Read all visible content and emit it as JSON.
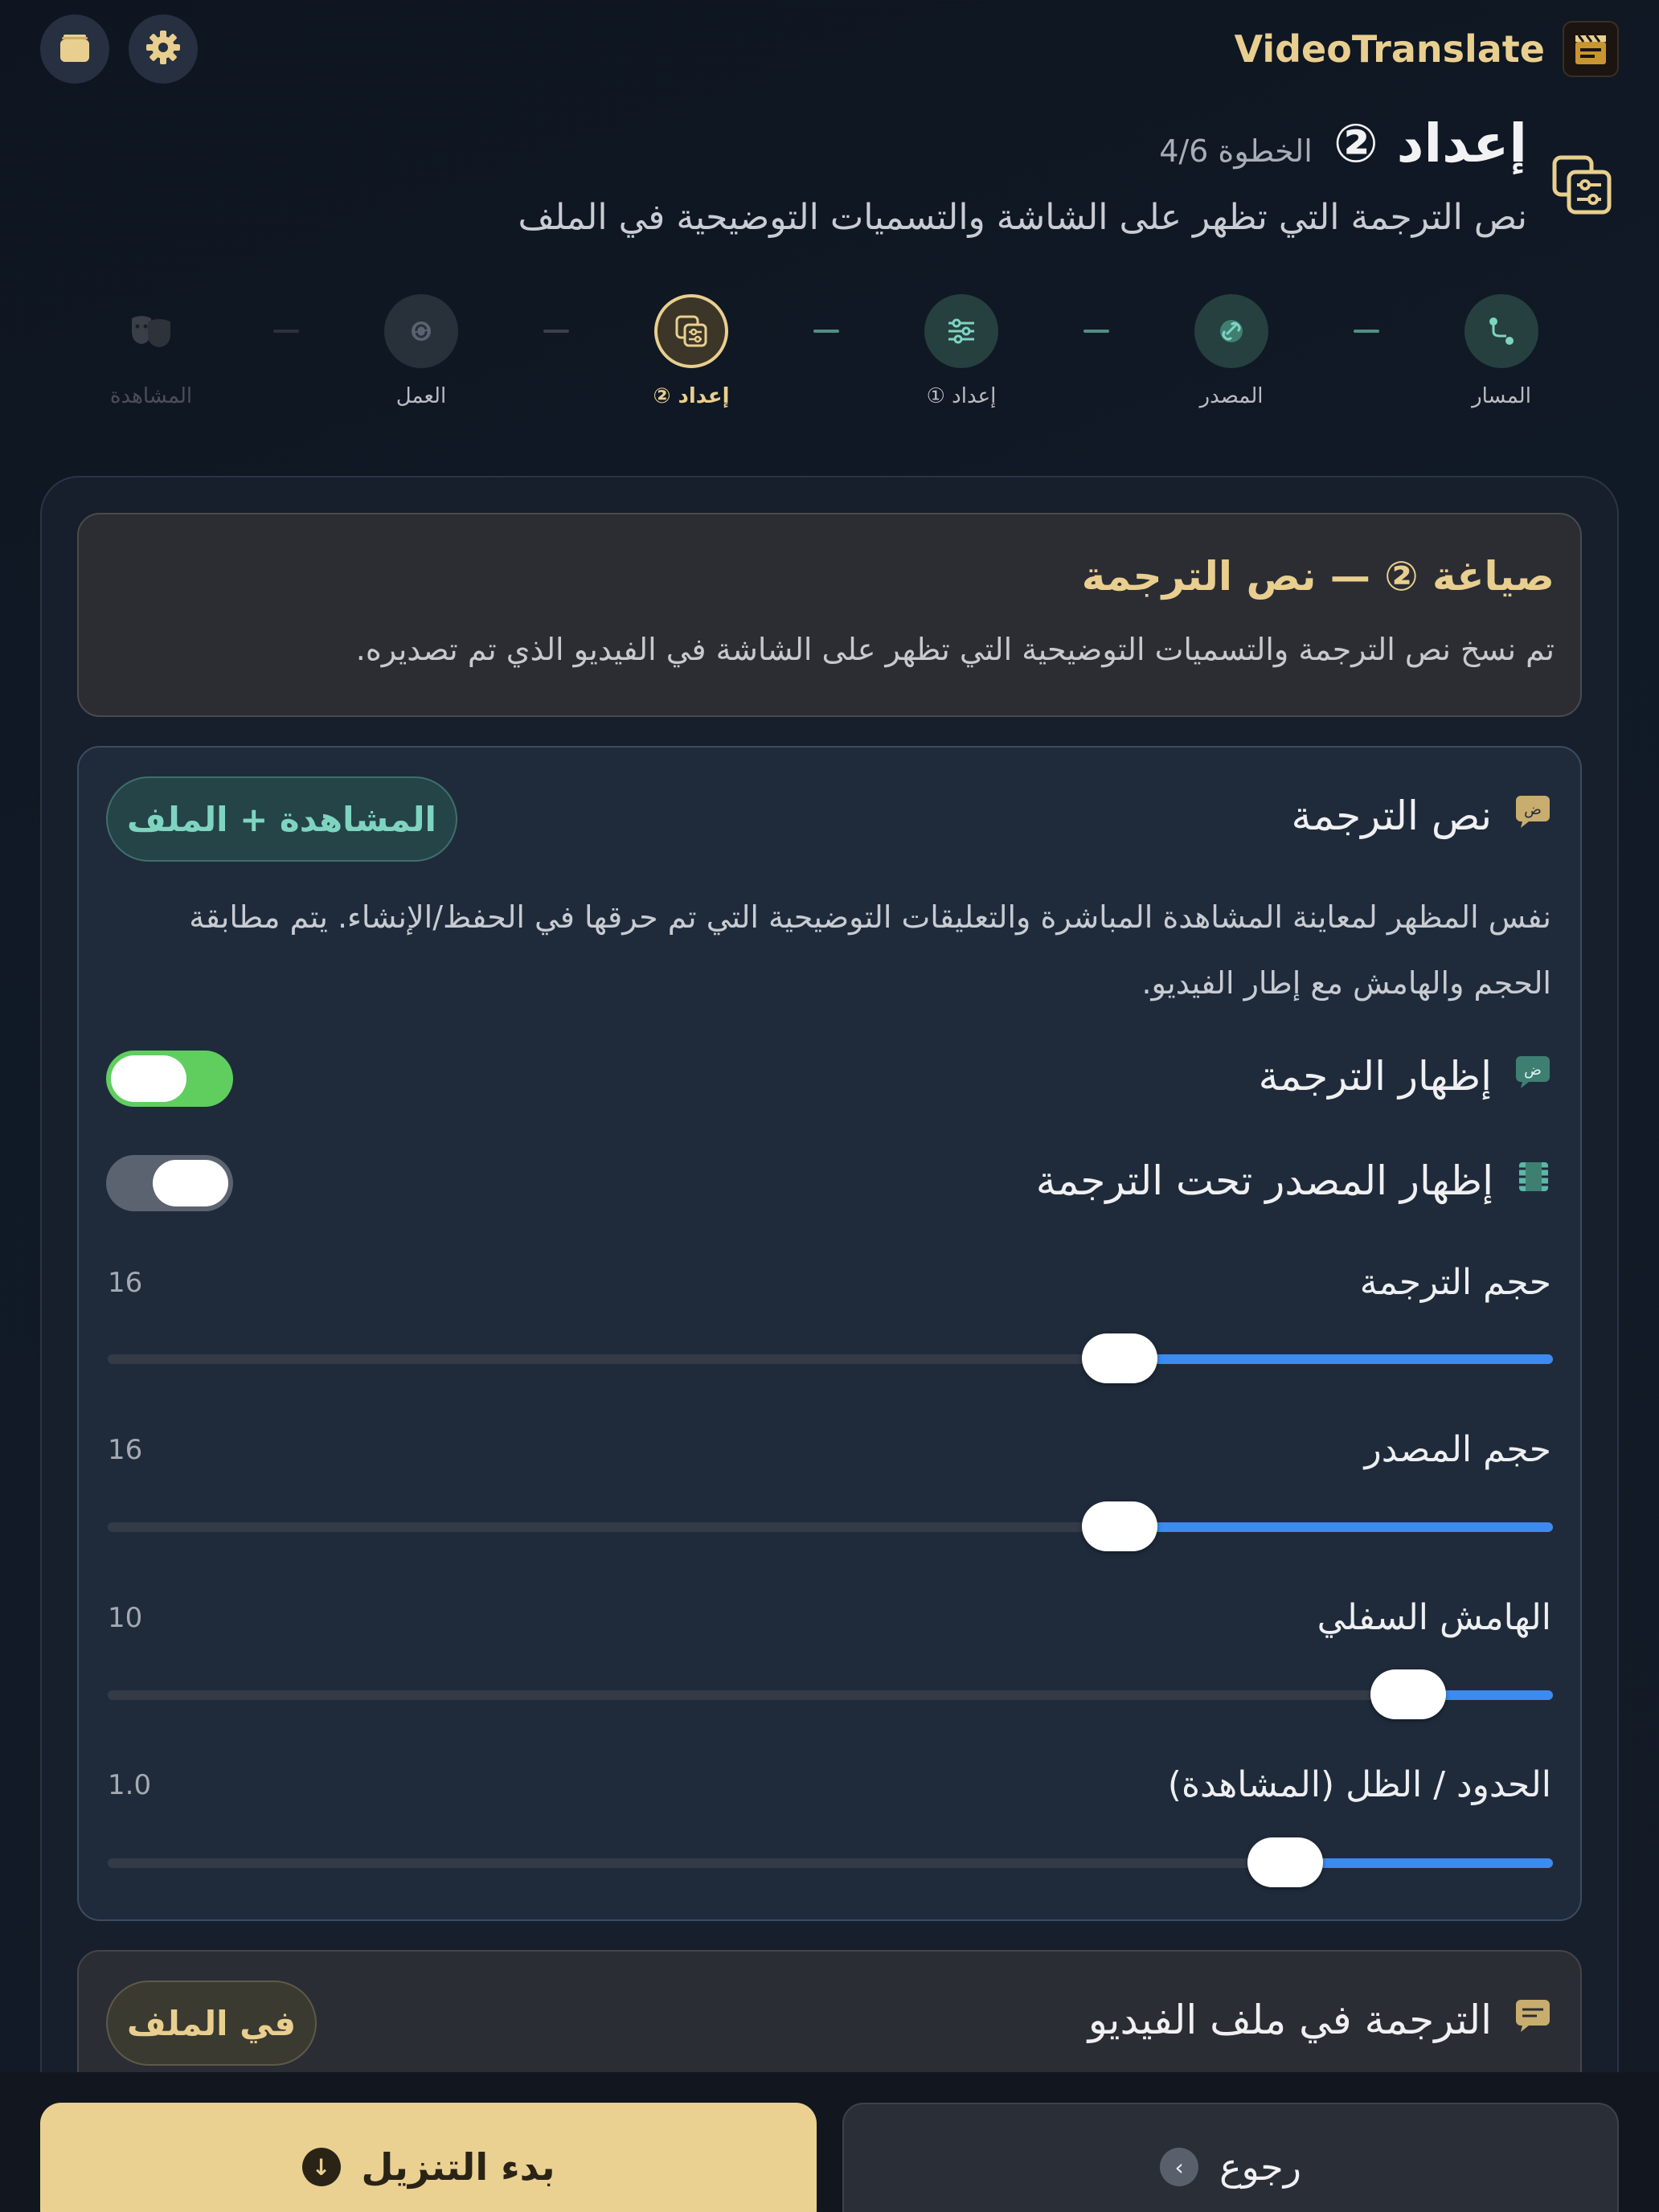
{
  "app": {
    "title": "VideoTranslate",
    "logo_icon": "film-slate-icon"
  },
  "topbar": {
    "settings_icon": "gear-icon",
    "library_icon": "stack-icon"
  },
  "header": {
    "title": "إعداد ②",
    "step": "الخطوة 4/6",
    "subtitle": "نص الترجمة التي تظهر على الشاشة والتسميات التوضيحية في الملف",
    "icon": "sliders-panel-icon"
  },
  "stepper": {
    "steps": [
      {
        "label": "المسار",
        "icon": "route-icon",
        "state": "done"
      },
      {
        "label": "المصدر",
        "icon": "link-icon",
        "state": "done"
      },
      {
        "label": "إعداد ①",
        "icon": "sliders-icon",
        "state": "done"
      },
      {
        "label": "إعداد ②",
        "icon": "sliders-panel-icon",
        "state": "active"
      },
      {
        "label": "العمل",
        "icon": "refresh-icon",
        "state": "upcoming"
      },
      {
        "label": "المشاهدة",
        "icon": "theater-masks-icon",
        "state": "disabled"
      }
    ]
  },
  "info_card": {
    "title": "صياغة ② — نص الترجمة",
    "text": "تم نسخ نص الترجمة والتسميات التوضيحية التي تظهر على الشاشة في الفيديو الذي تم تصديره."
  },
  "subtitle_section": {
    "title": "نص الترجمة",
    "icon": "subtitle-bubble-icon",
    "chip": "المشاهدة + الملف",
    "description": "نفس المظهر لمعاينة المشاهدة المباشرة والتعليقات التوضيحية التي تم حرقها في الحفظ/الإنشاء. يتم مطابقة الحجم والهامش مع إطار الفيديو.",
    "toggles": [
      {
        "label": "إظهار الترجمة",
        "icon": "subtitle-bubble-icon",
        "on": true
      },
      {
        "label": "إظهار المصدر تحت الترجمة",
        "icon": "film-icon",
        "on": false
      }
    ],
    "sliders": [
      {
        "label": "حجم الترجمة",
        "value": "16",
        "level": 0.3
      },
      {
        "label": "حجم المصدر",
        "value": "16",
        "level": 0.3
      },
      {
        "label": "الهامش السفلي",
        "value": "10",
        "level": 0.1
      },
      {
        "label": "الحدود / الظل (المشاهدة)",
        "value": "1.0",
        "level": 0.185
      }
    ]
  },
  "file_section": {
    "title": "الترجمة في ملف الفيديو",
    "icon": "caption-icon",
    "chip": "في الملف"
  },
  "footer": {
    "primary": "بدء التنزيل",
    "primary_icon": "download-arrow-icon",
    "secondary": "رجوع",
    "secondary_icon": "chevron-right-icon"
  },
  "colors": {
    "accent_gold": "#e9cf8f",
    "accent_teal": "#7fd4c0",
    "toggle_on": "#5fce5f",
    "slider_fill": "#3d8bf0",
    "background": "#101a26"
  }
}
